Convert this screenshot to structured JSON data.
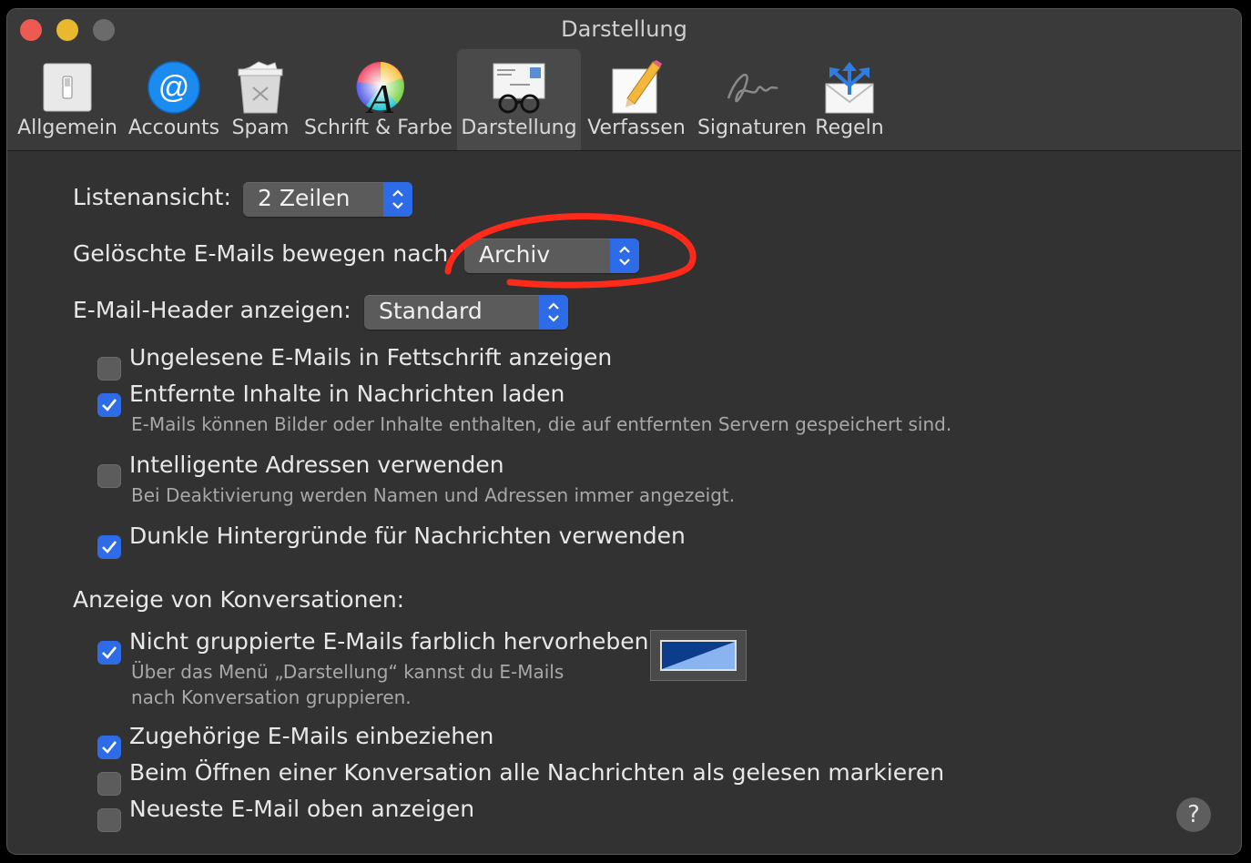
{
  "window": {
    "title": "Darstellung"
  },
  "toolbar": {
    "items": [
      {
        "label": "Allgemein",
        "icon": "switch-icon"
      },
      {
        "label": "Accounts",
        "icon": "at-icon"
      },
      {
        "label": "Spam",
        "icon": "trash-icon"
      },
      {
        "label": "Schrift & Farbe",
        "icon": "font-color-icon"
      },
      {
        "label": "Darstellung",
        "icon": "glasses-envelope-icon",
        "active": true
      },
      {
        "label": "Verfassen",
        "icon": "pencil-note-icon"
      },
      {
        "label": "Signaturen",
        "icon": "signature-icon"
      },
      {
        "label": "Regeln",
        "icon": "rules-envelope-icon"
      }
    ]
  },
  "settings": {
    "list_view": {
      "label": "Listenansicht:",
      "value": "2 Zeilen"
    },
    "move_deleted": {
      "label": "Gelöschte E-Mails bewegen nach:",
      "value": "Archiv"
    },
    "header": {
      "label": "E-Mail-Header anzeigen:",
      "value": "Standard"
    },
    "bold_unread": {
      "label": "Ungelesene E-Mails in Fettschrift anzeigen",
      "checked": false
    },
    "load_remote": {
      "label": "Entfernte Inhalte in Nachrichten laden",
      "checked": true,
      "hint": "E-Mails können Bilder oder Inhalte enthalten, die auf entfernten Servern gespeichert sind."
    },
    "smart_addresses": {
      "label": "Intelligente Adressen verwenden",
      "checked": false,
      "hint": "Bei Deaktivierung werden Namen und Adressen immer angezeigt."
    },
    "dark_backgrounds": {
      "label": "Dunkle Hintergründe für Nachrichten verwenden",
      "checked": true
    }
  },
  "conversations": {
    "heading": "Anzeige von Konversationen:",
    "highlight": {
      "label": "Nicht gruppierte E-Mails farblich hervorheben",
      "checked": true,
      "hint_line1": "Über das Menü „Darstellung“ kannst du E-Mails",
      "hint_line2": "nach Konversation gruppieren.",
      "color_dark": "#0b3d8c",
      "color_light": "#8ab4f0"
    },
    "related": {
      "label": "Zugehörige E-Mails einbeziehen",
      "checked": true
    },
    "mark_read": {
      "label": "Beim Öffnen einer Konversation alle Nachrichten als gelesen markieren",
      "checked": false
    },
    "newest_top": {
      "label": "Neueste E-Mail oben anzeigen",
      "checked": false
    }
  },
  "help": {
    "label": "?"
  },
  "colors": {
    "accent": "#2e6be6",
    "annotation": "#ff2a1a"
  }
}
